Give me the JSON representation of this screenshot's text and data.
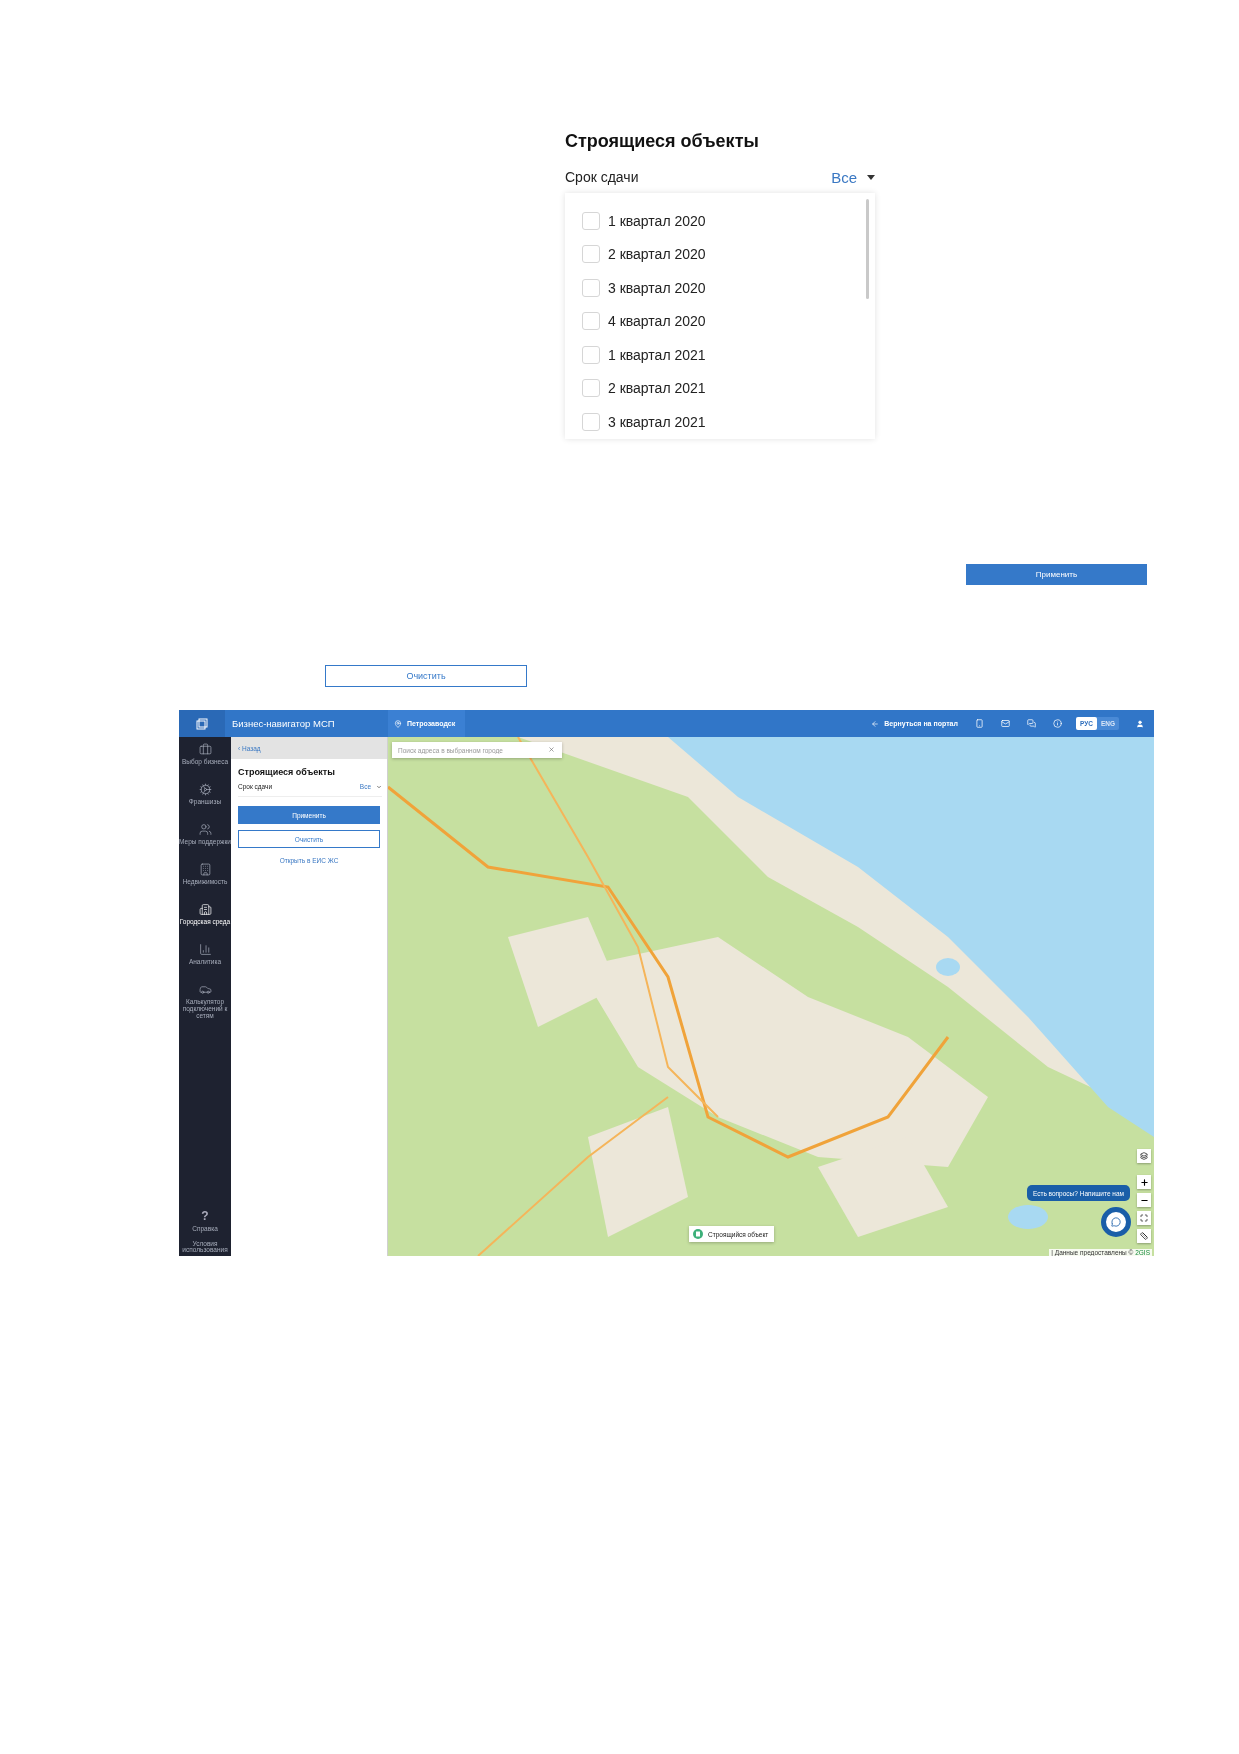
{
  "filter_popup": {
    "title": "Строящиеся объекты",
    "field_label": "Срок сдачи",
    "field_value": "Все",
    "options": [
      {
        "label": "1 квартал 2020",
        "checked": false
      },
      {
        "label": "2 квартал 2020",
        "checked": false
      },
      {
        "label": "3 квартал 2020",
        "checked": false
      },
      {
        "label": "4 квартал 2020",
        "checked": false
      },
      {
        "label": "1 квартал 2021",
        "checked": false
      },
      {
        "label": "2 квартал 2021",
        "checked": false
      },
      {
        "label": "3 квартал 2021",
        "checked": false
      }
    ]
  },
  "apply_button": {
    "label": "Применить"
  },
  "clear_button": {
    "label": "Очистить"
  },
  "app": {
    "header": {
      "title": "Бизнес-навигатор МСП",
      "city": "Петрозаводск",
      "back_link": "Вернуться на портал",
      "languages": [
        {
          "label": "РУС",
          "selected": true
        },
        {
          "label": "ENG",
          "selected": false
        }
      ]
    },
    "sidebar": {
      "items": [
        {
          "label": "Выбор бизнеса",
          "selected": false
        },
        {
          "label": "Франшизы",
          "selected": false
        },
        {
          "label": "Меры поддержки",
          "selected": false
        },
        {
          "label": "Недвижимость",
          "selected": false
        },
        {
          "label": "Городская среда",
          "selected": true
        },
        {
          "label": "Аналитика",
          "selected": false
        },
        {
          "label": "Калькулятор подключений к сетям",
          "selected": false
        }
      ],
      "help_glyph": "?",
      "help_label": "Справка",
      "terms_label": "Условия использования"
    },
    "panel": {
      "back": "‹ Назад",
      "title": "Строящиеся объекты",
      "field_label": "Срок сдачи",
      "field_value": "Все",
      "apply": "Применить",
      "clear": "Очистить",
      "link": "Открыть в ЕИС ЖС"
    },
    "map": {
      "kind": "picture",
      "search_placeholder": "Поиск адреса в выбранном городе",
      "legend": "Строящийся объект",
      "chat_prompt": "Есть вопросы? Напишите нам",
      "attribution": "| Данные предоставлены ©",
      "attribution_brand": "2GIS"
    }
  }
}
